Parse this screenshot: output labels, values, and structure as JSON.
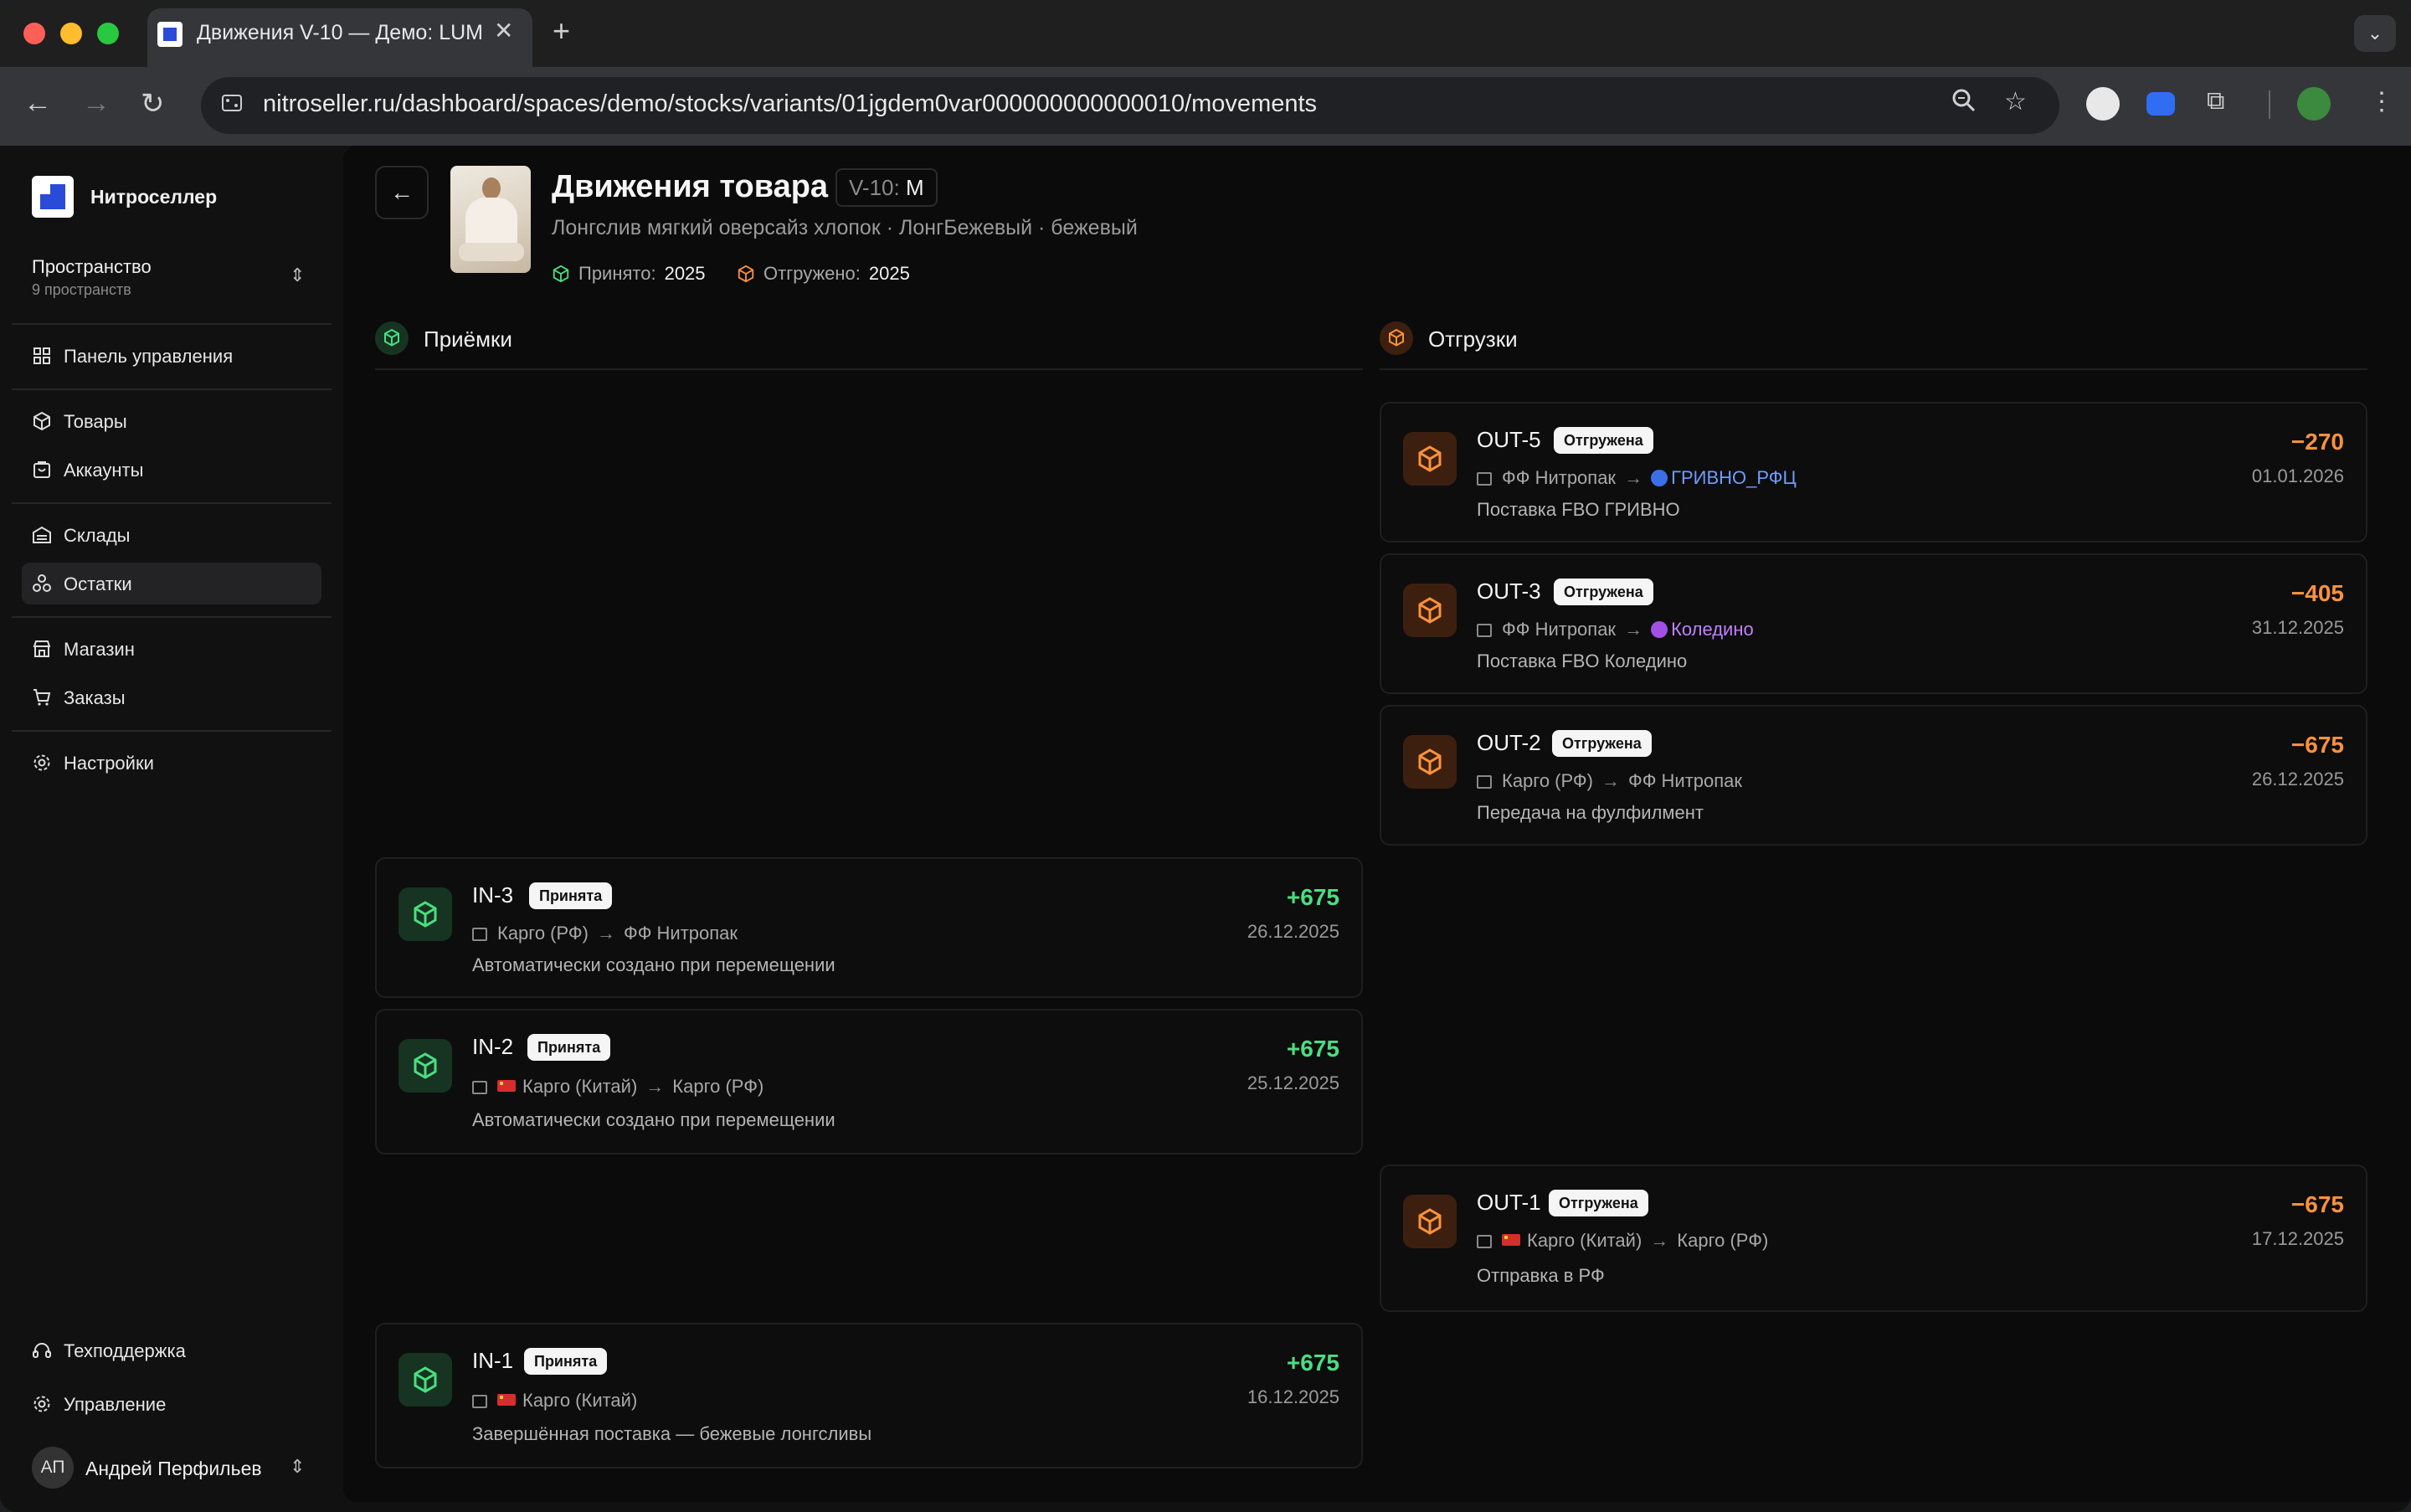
{
  "browser": {
    "tab_title": "Движения V-10 — Демо: LUM",
    "url": "nitroseller.ru/dashboard/spaces/demo/stocks/variants/01jgdem0var000000000000010/movements"
  },
  "sidebar": {
    "brand": "Нитроселлер",
    "space_title": "Пространство",
    "space_sub": "9 пространств",
    "items": [
      {
        "label": "Панель управления",
        "icon": "dashboard-icon"
      },
      {
        "label": "Товары",
        "icon": "box-icon"
      },
      {
        "label": "Аккаунты",
        "icon": "account-icon"
      },
      {
        "label": "Склады",
        "icon": "warehouse-icon"
      },
      {
        "label": "Остатки",
        "icon": "stock-icon"
      },
      {
        "label": "Магазин",
        "icon": "store-icon"
      },
      {
        "label": "Заказы",
        "icon": "cart-icon"
      },
      {
        "label": "Настройки",
        "icon": "gear-icon"
      }
    ],
    "bottom": [
      {
        "label": "Техподдержка",
        "icon": "headset-icon"
      },
      {
        "label": "Управление",
        "icon": "gear-icon"
      }
    ],
    "user": {
      "initials": "АП",
      "name": "Андрей Перфильев"
    }
  },
  "header": {
    "title": "Движения товара",
    "variant_prefix": "V-10:",
    "variant_size": "M",
    "subtitle": "Лонгслив мягкий оверсайз хлопок · ЛонгБежевый · бежевый",
    "received_label": "Принято:",
    "received_value": "2025",
    "shipped_label": "Отгружено:",
    "shipped_value": "2025"
  },
  "receipts": {
    "title": "Приёмки",
    "cards": [
      {
        "code": "IN-3",
        "status": "Принята",
        "from": "Карго (РФ)",
        "to": "ФФ Нитропак",
        "note": "Автоматически создано при перемещении",
        "qty": "+675",
        "date": "26.12.2025"
      },
      {
        "code": "IN-2",
        "status": "Принята",
        "from": "Карго (Китай)",
        "to": "Карго (РФ)",
        "note": "Автоматически создано при перемещении",
        "qty": "+675",
        "date": "25.12.2025"
      },
      {
        "code": "IN-1",
        "status": "Принята",
        "from": "Карго (Китай)",
        "to": "",
        "note": "Завершённая поставка — бежевые лонгсливы",
        "qty": "+675",
        "date": "16.12.2025"
      }
    ]
  },
  "shipments": {
    "title": "Отгрузки",
    "cards": [
      {
        "code": "OUT-5",
        "status": "Отгружена",
        "from": "ФФ Нитропак",
        "to": "ГРИВНО_РФЦ",
        "note": "Поставка FBO ГРИВНО",
        "qty": "−270",
        "date": "01.01.2026"
      },
      {
        "code": "OUT-3",
        "status": "Отгружена",
        "from": "ФФ Нитропак",
        "to": "Коледино",
        "note": "Поставка FBO Коледино",
        "qty": "−405",
        "date": "31.12.2025"
      },
      {
        "code": "OUT-2",
        "status": "Отгружена",
        "from": "Карго (РФ)",
        "to": "ФФ Нитропак",
        "note": "Передача на фулфилмент",
        "qty": "−675",
        "date": "26.12.2025"
      },
      {
        "code": "OUT-1",
        "status": "Отгружена",
        "from": "Карго (Китай)",
        "to": "Карго (РФ)",
        "note": "Отправка в РФ",
        "qty": "−675",
        "date": "17.12.2025"
      }
    ]
  },
  "colors": {
    "accent_in": "#4ade80",
    "accent_out": "#fb923c",
    "brand": "#2a4bd7"
  }
}
